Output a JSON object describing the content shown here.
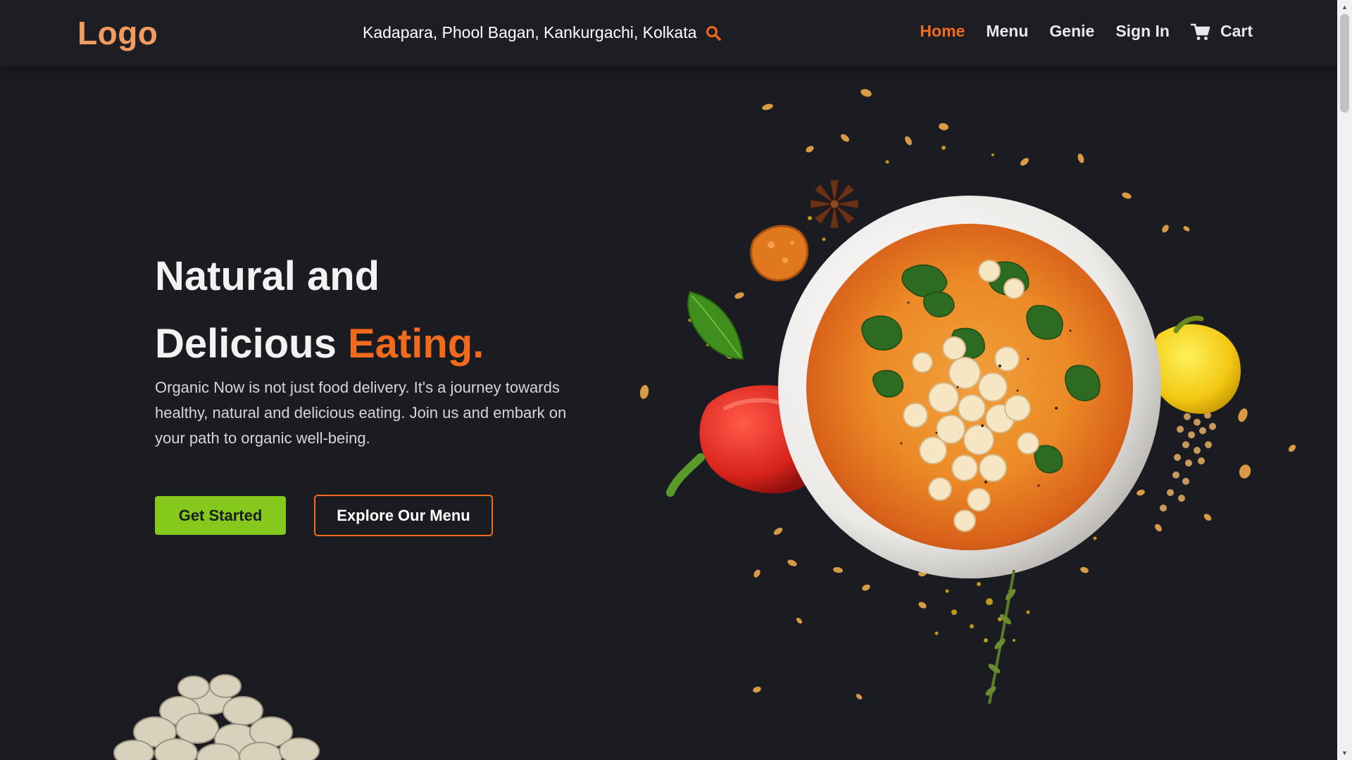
{
  "header": {
    "logo": "Logo",
    "location": "Kadapara, Phool Bagan, Kankurgachi, Kolkata",
    "search_icon": "search-icon",
    "nav": {
      "home": "Home",
      "menu": "Menu",
      "genie": "Genie",
      "sign_in": "Sign In",
      "cart": "Cart"
    },
    "cart_icon": "cart-icon"
  },
  "hero": {
    "title_line1": "Natural and",
    "title_line2_plain": "Delicious ",
    "title_line2_accent": "Eating.",
    "description": "Organic Now is not just food delivery. It's a journey towards healthy, natural and delicious eating. Join us and embark on your path to organic well-being.",
    "cta_primary": "Get Started",
    "cta_secondary": "Explore Our Menu"
  },
  "colors": {
    "background": "#1a1c22",
    "accent_orange": "#f26a1b",
    "logo_orange": "#f39a5f",
    "accent_green": "#84c91c"
  }
}
